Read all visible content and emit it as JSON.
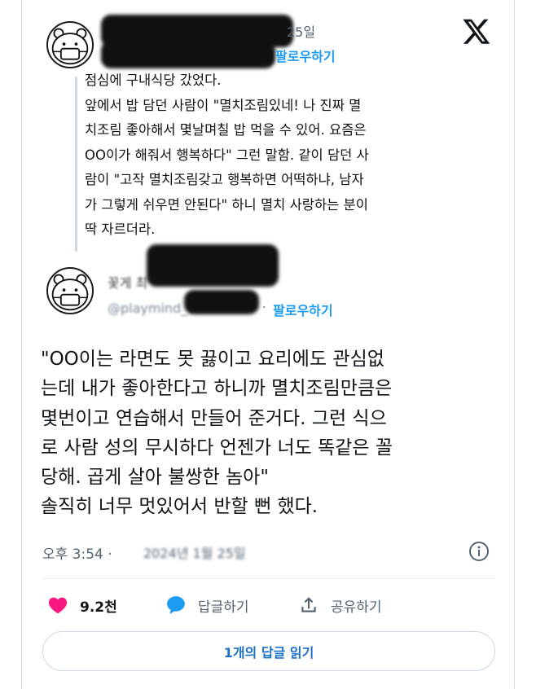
{
  "tweet1": {
    "date_fragment": "25일",
    "follow_label": "팔로우하기",
    "text": "점심에 구내식당 갔었다.\n앞에서 밥 담던 사람이 \"멸치조림있네! 나 진짜 멸\n치조림 좋아해서 몇날며칠 밥 먹을 수 있어. 요즘은\nOO이가 해줘서 행복하다\" 그런 말함. 같이 담던 사\n람이 \"고작 멸치조림갖고 행복하면 어떡하냐, 남자\n가 그렇게 쉬우면 안된다\" 하니 멸치 사랑하는 분이\n딱 자르더라."
  },
  "tweet2": {
    "name_fragment": "꽃게 최",
    "handle_fragment": "@playmind_of",
    "follow_label": "팔로우하기",
    "text": "\"OO이는 라면도 못 끓이고 요리에도 관심없\n는데 내가 좋아한다고 하니까 멸치조림만큼은\n몇번이고 연습해서 만들어 준거다. 그런 식으\n로 사람 성의 무시하다 언젠가 너도 똑같은 꼴\n당해. 곱게 살아 불쌍한 놈아\"\n솔직히 너무 멋있어서 반할 뻔 했다.",
    "time": "오후 3:54 ·",
    "date": "2024년 1월 25일"
  },
  "actions": {
    "likes": "9.2천",
    "reply_label": "답글하기",
    "share_label": "공유하기"
  },
  "read_replies_label": "1개의 답글 읽기",
  "colors": {
    "accent": "#1d9bf0",
    "like": "#f91880",
    "text": "#0f1419",
    "muted": "#536471"
  },
  "icons": [
    "x-logo-icon",
    "info-icon",
    "heart-icon",
    "reply-bubble-icon",
    "share-icon"
  ]
}
